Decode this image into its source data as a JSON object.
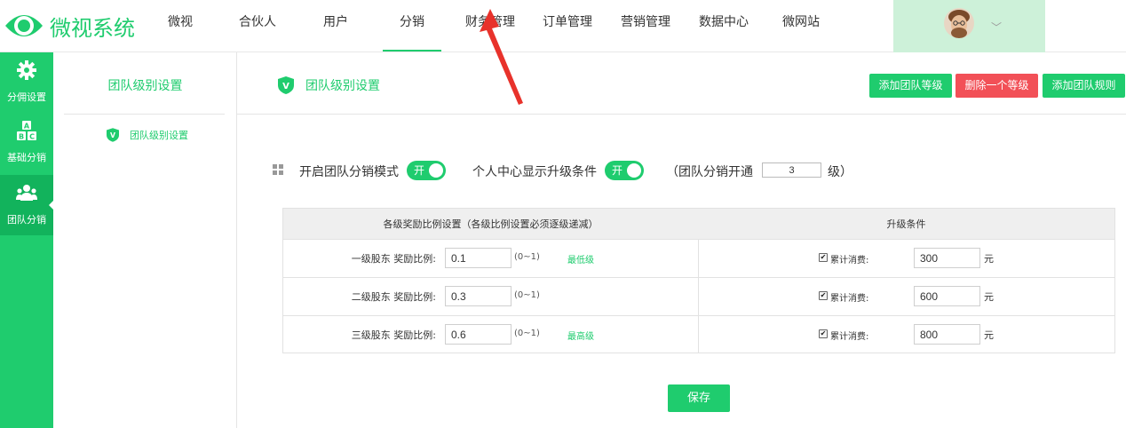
{
  "app": {
    "name": "微视系统"
  },
  "nav": {
    "items": [
      "微视",
      "合伙人",
      "用户",
      "分销",
      "财务管理",
      "订单管理",
      "营销管理",
      "数据中心",
      "微网站"
    ],
    "active": "分销"
  },
  "sidebar": {
    "items": [
      {
        "label": "分佣设置",
        "icon": "gear-icon"
      },
      {
        "label": "基础分销",
        "icon": "abc-blocks-icon"
      },
      {
        "label": "团队分销",
        "icon": "team-icon"
      }
    ],
    "active": "团队分销"
  },
  "submenu": {
    "title": "团队级别设置",
    "items": [
      {
        "label": "团队级别设置",
        "icon": "shield-v-icon"
      }
    ]
  },
  "page": {
    "title": "团队级别设置",
    "buttons": {
      "add_level": "添加团队等级",
      "delete_level": "删除一个等级",
      "add_rule": "添加团队规则"
    }
  },
  "options": {
    "team_mode_label": "开启团队分销模式",
    "team_mode_toggle": "开",
    "show_condition_label": "个人中心显示升级条件",
    "show_condition_toggle": "开",
    "levels_prefix": "（团队分销开通",
    "levels_value": "3",
    "levels_suffix": "级）"
  },
  "table": {
    "headers": [
      "各级奖励比例设置（各级比例设置必须逐级递减）",
      "升级条件"
    ],
    "rows": [
      {
        "label": "一级股东 奖励比例:",
        "ratio": "0.1",
        "range": "(0~1)",
        "tag": "最低级",
        "cond_label": "累计消费:",
        "amount": "300",
        "unit": "元"
      },
      {
        "label": "二级股东 奖励比例:",
        "ratio": "0.3",
        "range": "(0~1)",
        "tag": "",
        "cond_label": "累计消费:",
        "amount": "600",
        "unit": "元"
      },
      {
        "label": "三级股东 奖励比例:",
        "ratio": "0.6",
        "range": "(0~1)",
        "tag": "最高级",
        "cond_label": "累计消费:",
        "amount": "800",
        "unit": "元"
      }
    ]
  },
  "save_label": "保存",
  "colors": {
    "brand": "#1fcc6e",
    "danger": "#f25057",
    "sidebar_active": "#12b35c",
    "user_box": "#cdf1d9"
  }
}
